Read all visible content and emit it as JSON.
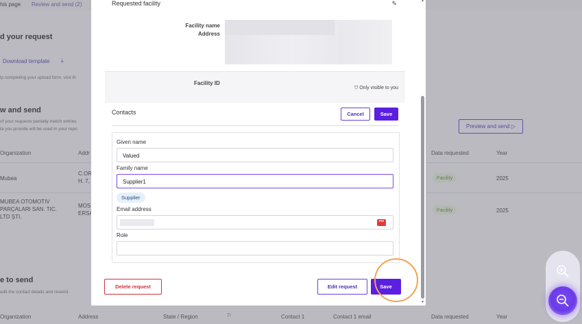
{
  "background": {
    "top_tabs": [
      "his page",
      "Review and send (2)"
    ],
    "upload_heading": "d your request",
    "download_template": "Download template",
    "upload_help": "lp completing your upload form, visit th",
    "review_heading": "w and send",
    "review_note1": "of your requests partially match entries",
    "review_note2": "ta you provide will be used in your repo",
    "preview_button": "Preview and send",
    "columns": [
      "Organization",
      "Addr",
      "Data requested",
      "Year"
    ],
    "rows": [
      {
        "org": "Mubea",
        "addr": "C.OR\nH. 7,",
        "data": "Facility",
        "year": "2025"
      },
      {
        "org": "MUBEA OTOMOTIV\nPARÇALARI SAN. TIC.\nLTD ŞTI.",
        "addr": "MOS\nERSA",
        "data": "Facility",
        "year": "2025"
      }
    ],
    "to_send_heading": "e to send",
    "to_send_note": "edit the contact details and resend.",
    "bottom_columns": [
      "Organization",
      "Address",
      "State / Region",
      "Contact 1",
      "Contact 1 email",
      "Data requested",
      "Year"
    ]
  },
  "modal": {
    "requested_facility_title": "Requested facility",
    "facility_name_label": "Facility name",
    "address_label": "Address",
    "facility_id_label": "Facility ID",
    "only_visible": "Only visible to you",
    "contacts_title": "Contacts",
    "cancel_label": "Cancel",
    "save_label": "Save",
    "given_name_label": "Given name",
    "given_name_value": "Valued",
    "family_name_label": "Family name",
    "family_name_value": "Supplier1",
    "contact_tag": "Supplier",
    "email_label": "Email address",
    "role_label": "Role",
    "role_value": "",
    "delete_request": "Delete request",
    "edit_request": "Edit request",
    "footer_save": "Save"
  },
  "colors": {
    "accent": "#5a1fe0",
    "danger": "#c9333c",
    "ring": "#f4a14e",
    "pill_green": "#5a8a3c"
  },
  "zoom": {
    "in_icon": "zoom-in-icon",
    "out_icon": "zoom-out-icon"
  }
}
